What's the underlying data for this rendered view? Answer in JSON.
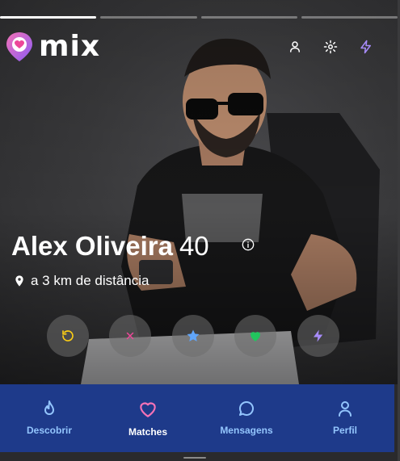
{
  "app": {
    "name": "mix"
  },
  "header": {
    "icons": [
      "user-icon",
      "gear-icon",
      "bolt-icon"
    ]
  },
  "progress": {
    "segments": 4,
    "active_index": 0
  },
  "profile": {
    "name": "Alex Oliveira",
    "age": "40",
    "distance": "a 3 km de distância"
  },
  "actions": [
    {
      "name": "rewind-button",
      "icon": "rewind-icon",
      "color": "#facc15"
    },
    {
      "name": "dislike-button",
      "icon": "x-icon",
      "color": "#ec4899"
    },
    {
      "name": "super-like-button",
      "icon": "star-icon",
      "color": "#60a5fa"
    },
    {
      "name": "like-button",
      "icon": "heart-icon",
      "color": "#22c55e"
    },
    {
      "name": "boost-button",
      "icon": "bolt-icon",
      "color": "#a78bfa"
    }
  ],
  "nav": {
    "items": [
      {
        "label": "Descobrir",
        "icon": "flame-icon",
        "active": false
      },
      {
        "label": "Matches",
        "icon": "heart-icon",
        "active": true
      },
      {
        "label": "Mensagens",
        "icon": "message-icon",
        "active": false
      },
      {
        "label": "Perfil",
        "icon": "user-icon",
        "active": false
      }
    ],
    "active_color": "#ffffff",
    "inactive_color": "#93c5fd",
    "background": "#1e3a8a",
    "accent": "#f472b6"
  }
}
